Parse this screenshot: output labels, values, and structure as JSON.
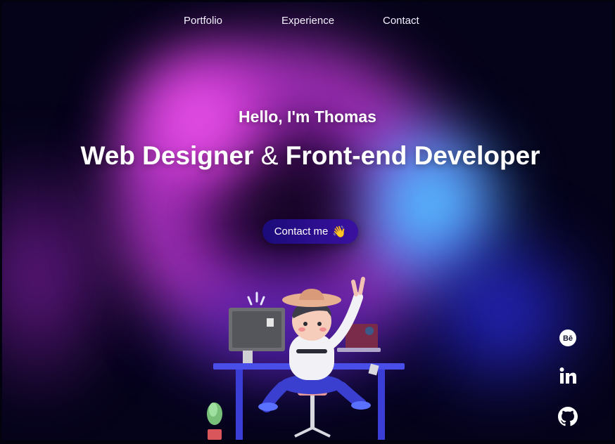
{
  "nav": {
    "items": [
      {
        "label": "Portfolio"
      },
      {
        "label": "Experience"
      },
      {
        "label": "Contact"
      }
    ]
  },
  "hero": {
    "greeting": "Hello, I'm Thomas",
    "headline_part1": "Web Designer",
    "headline_amp": "&",
    "headline_part2": "Front-end Developer",
    "cta_label": "Contact me",
    "cta_emoji": "👋"
  },
  "social": [
    {
      "icon": "behance-icon",
      "label": "Bē"
    },
    {
      "icon": "linkedin-icon",
      "label": "in"
    },
    {
      "icon": "github-icon",
      "label": ""
    }
  ],
  "colors": {
    "background": "#05031a",
    "cta_start": "#1b0b7a",
    "cta_end": "#3a10a0",
    "glow_pink": "#ff6cf5",
    "glow_cyan": "#6ee6ff",
    "glow_blue": "#2a2ad8"
  }
}
